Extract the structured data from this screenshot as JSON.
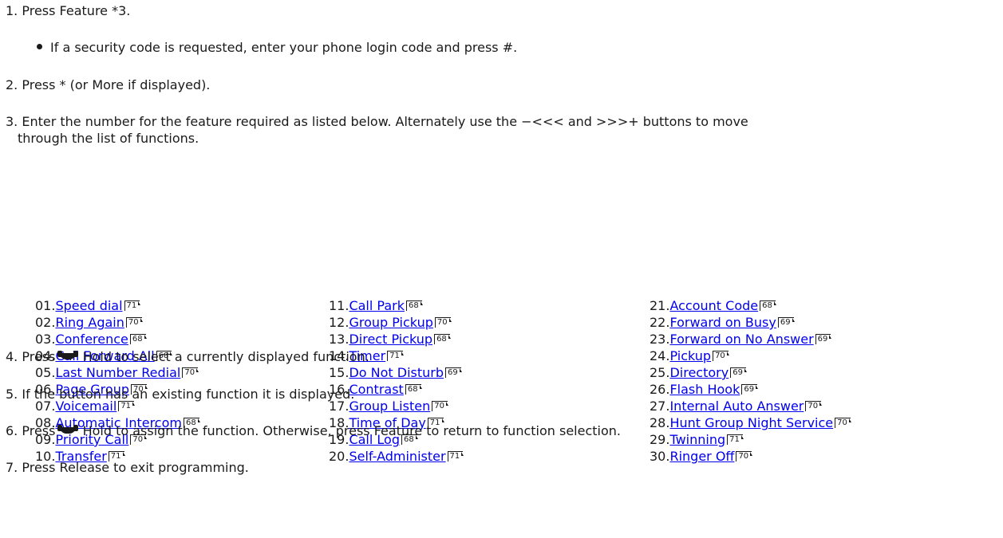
{
  "steps": {
    "s1": {
      "num": "1.",
      "text": "Press Feature *3."
    },
    "s1_bullet": "If a security code is requested, enter your phone login code and press #.",
    "s2": {
      "num": "2.",
      "text": "Press * (or More if displayed)."
    },
    "s3": {
      "num": "3.",
      "text_line1": "Enter the number for the feature required as listed below. Alternately use the −<<< and >>>+ buttons to move",
      "text_line2": "through the list of functions."
    },
    "s4": {
      "num": "4.",
      "pre": "Press",
      "post": "Hold to select a currently displayed function."
    },
    "s5": {
      "num": "5.",
      "text": "If the button has an existing function it is displayed."
    },
    "s6": {
      "num": "6.",
      "pre": "Press",
      "post": "Hold to assign the function. Otherwise, press Feature to return to function selection."
    },
    "s7": {
      "num": "7.",
      "text": "Press Release to exit programming."
    }
  },
  "features": {
    "col1": [
      {
        "idx": "01.",
        "name": "Speed dial",
        "page": "71"
      },
      {
        "idx": "02.",
        "name": "Ring Again",
        "page": "70"
      },
      {
        "idx": "03.",
        "name": "Conference",
        "page": "68"
      },
      {
        "idx": "04.",
        "name": "Call Forward All",
        "page": "68"
      },
      {
        "idx": "05.",
        "name": "Last Number Redial",
        "page": "70"
      },
      {
        "idx": "06.",
        "name": "Page Group",
        "page": "70"
      },
      {
        "idx": "07.",
        "name": "Voicemail",
        "page": "71"
      },
      {
        "idx": "08.",
        "name": "Automatic Intercom",
        "page": "68"
      },
      {
        "idx": "09.",
        "name": "Priority Call",
        "page": "70"
      },
      {
        "idx": "10.",
        "name": "Transfer",
        "page": "71"
      }
    ],
    "col2": [
      {
        "idx": "11.",
        "name": "Call Park",
        "page": "68"
      },
      {
        "idx": "12.",
        "name": "Group Pickup",
        "page": "70"
      },
      {
        "idx": "13.",
        "name": "Direct Pickup",
        "page": "68"
      },
      {
        "idx": "14.",
        "name": "Timer",
        "page": "71"
      },
      {
        "idx": "15.",
        "name": "Do Not Disturb",
        "page": "69"
      },
      {
        "idx": "16.",
        "name": "Contrast",
        "page": "68"
      },
      {
        "idx": "17.",
        "name": "Group Listen",
        "page": "70"
      },
      {
        "idx": "18.",
        "name": "Time of Day",
        "page": "71"
      },
      {
        "idx": "19.",
        "name": "Call Log",
        "page": "68"
      },
      {
        "idx": "20.",
        "name": "Self-Administer",
        "page": "71"
      }
    ],
    "col3": [
      {
        "idx": "21.",
        "name": "Account Code",
        "page": "68"
      },
      {
        "idx": "22.",
        "name": "Forward on Busy",
        "page": "69"
      },
      {
        "idx": "23.",
        "name": "Forward on No Answer",
        "page": "69"
      },
      {
        "idx": "24.",
        "name": "Pickup",
        "page": "70"
      },
      {
        "idx": "25.",
        "name": "Directory",
        "page": "69"
      },
      {
        "idx": "26.",
        "name": "Flash Hook",
        "page": "69"
      },
      {
        "idx": "27.",
        "name": "Internal Auto Answer",
        "page": "70"
      },
      {
        "idx": "28.",
        "name": "Hunt Group Night Service",
        "page": "70"
      },
      {
        "idx": "29.",
        "name": "Twinning",
        "page": "71"
      },
      {
        "idx": "30.",
        "name": "Ringer Off",
        "page": "70"
      }
    ]
  },
  "colors": {
    "link": "#0000ee",
    "text": "#1a1a1a"
  },
  "icons": {
    "hold": "hold-handset-icon",
    "page_ref": "page-reference-icon"
  }
}
